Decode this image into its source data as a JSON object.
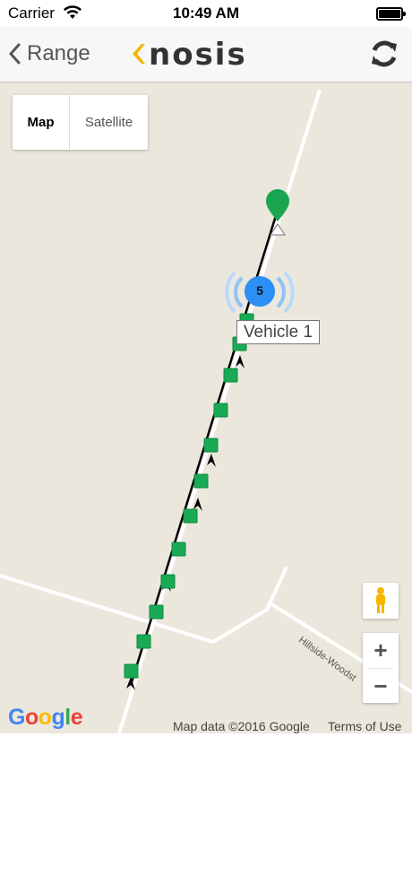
{
  "status_bar": {
    "carrier": "Carrier",
    "time": "10:49 AM",
    "wifi_icon": "wifi-icon",
    "battery_icon": "battery-full-icon"
  },
  "nav": {
    "back_label": "Range",
    "back_icon": "chevron-left-icon",
    "logo_text": "KNOSIS",
    "refresh_icon": "refresh-icon"
  },
  "map": {
    "map_type_options": [
      "Map",
      "Satellite"
    ],
    "selected_map_type": "Map",
    "vehicle_label": "Vehicle 1",
    "cluster_count": "5",
    "road_label": "Hillside-Woodst",
    "zoom_in_label": "+",
    "zoom_out_label": "−",
    "google_logo": "Google",
    "attribution": "Map data ©2016 Google",
    "terms": "Terms of Use",
    "marker_color": "#1aaa55",
    "pin_color": "#19a54f",
    "cluster_color": "#2b8ff5"
  }
}
